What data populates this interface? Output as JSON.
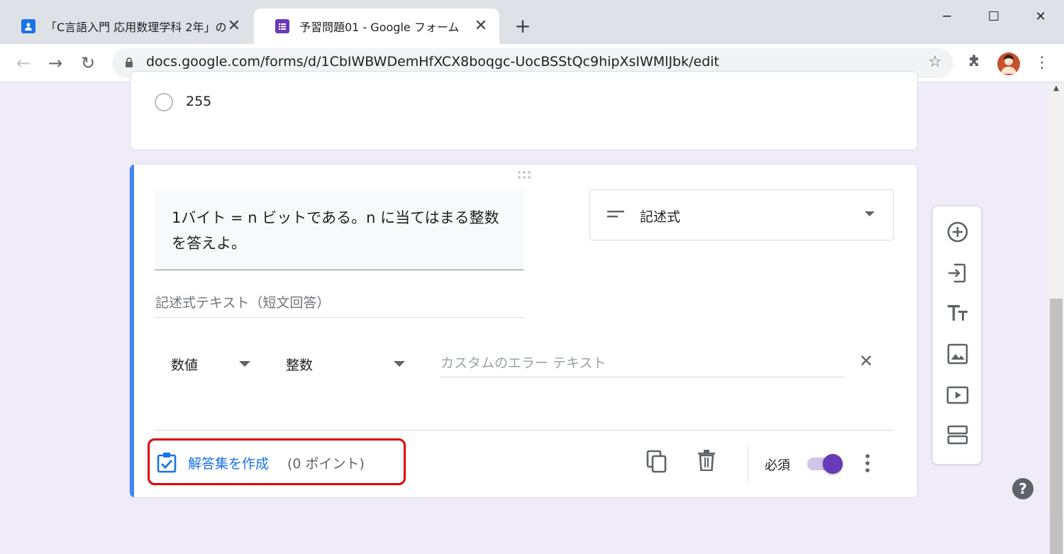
{
  "browser": {
    "tabs": [
      {
        "title": "「C言語入門 応用数理学科 2年」の",
        "icon": "google-classroom-icon",
        "active": false
      },
      {
        "title": "予習問題01 - Google フォーム",
        "icon": "google-forms-icon",
        "active": true
      }
    ],
    "url": "docs.google.com/forms/d/1CbIWBWDemHfXCX8boqgc-UocBSStQc9hipXsIWMlJbk/edit"
  },
  "previous_card": {
    "option_label": "255"
  },
  "question": {
    "title_text": "1バイト = n ビットである。n に当てはまる整数を答えよ。",
    "type_label": "記述式",
    "answer_placeholder": "記述式テキスト（短文回答）",
    "validation": {
      "category": "数値",
      "condition": "整数",
      "error_placeholder": "カスタムのエラー テキスト"
    },
    "answer_key": {
      "label": "解答集を作成",
      "points": "(0 ポイント)"
    },
    "required_label": "必須",
    "required_on": true
  },
  "colors": {
    "accent": "#4285f4",
    "form_purple": "#673ab7",
    "highlight_red": "#e00000",
    "link_blue": "#1a73e8"
  }
}
